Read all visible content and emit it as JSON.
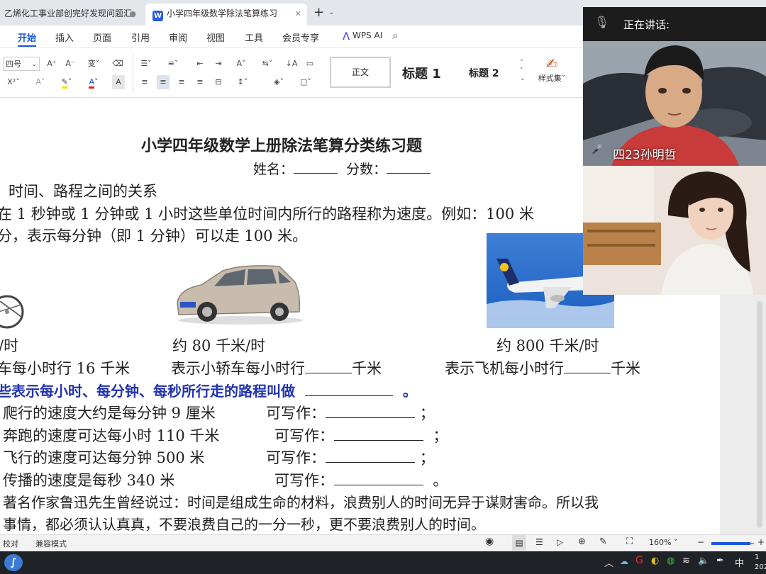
{
  "tabs": [
    {
      "label": "乙烯化工事业部创完好发现问题汇",
      "active": false
    },
    {
      "label": "小学四年级数学除法笔算练习",
      "active": true
    }
  ],
  "menu": [
    "开始",
    "插入",
    "页面",
    "引用",
    "审阅",
    "视图",
    "工具",
    "会员专享"
  ],
  "wps_ai": "WPS AI",
  "ribbon": {
    "font_size": "四号",
    "styles": [
      "正文",
      "标题 1",
      "标题 2"
    ],
    "style_set": "样式集"
  },
  "document": {
    "title": "小学四年级数学上册除法笔算分类练习题",
    "name_score": {
      "name": "姓名：",
      "score": "分数："
    },
    "section": "时间、路程之间的关系",
    "definition_1": "在 1 秒钟或 1 分钟或 1 小时这些单位时间内所行的路程称为速度。例如：100 米",
    "definition_2": "分，表示每分钟（即 1 分钟）可以走 100 米。",
    "speed_bike": "/时",
    "speed_car": "约 80 千米/时",
    "speed_plane": "约 800 千米/时",
    "line_bike": "车每小时行 16 千米",
    "line_car_pre": "表示小轿车每小时行",
    "line_car_unit": "千米",
    "line_plane_pre": "表示飞机每小时行",
    "line_plane_unit": "千米",
    "blue_line": "些表示每小时、每分钟、每秒所行走的路程叫做",
    "blue_end": "。",
    "ex1": "爬行的速度大约是每分钟 9 厘米",
    "ex2": "奔跑的速度可达每小时 110 千米",
    "ex3": "飞行的速度可达每分钟 500 米",
    "ex4": "传播的速度是每秒 340 米",
    "write_as": "可写作：",
    "semi": "；",
    "period": "。",
    "quote_1": "著名作家鲁迅先生曾经说过：时间是组成生命的材料，浪费别人的时间无异于谋财害命。所以我",
    "quote_2": "事情，都必须认认真真，不要浪费自己的一分一秒，更不要浪费别人的时间。"
  },
  "meeting": {
    "speaking_label": "正在讲话:",
    "participant_name": "四23孙明哲"
  },
  "status": {
    "proofread": "校对",
    "compat_mode": "兼容模式",
    "zoom": "160%"
  },
  "taskbar": {
    "ime": "中",
    "time_partial": "1",
    "date_partial": "202"
  },
  "colors": {
    "accent": "#1a56db",
    "blue_text": "#2233b0",
    "taskbar": "#1f2226"
  }
}
